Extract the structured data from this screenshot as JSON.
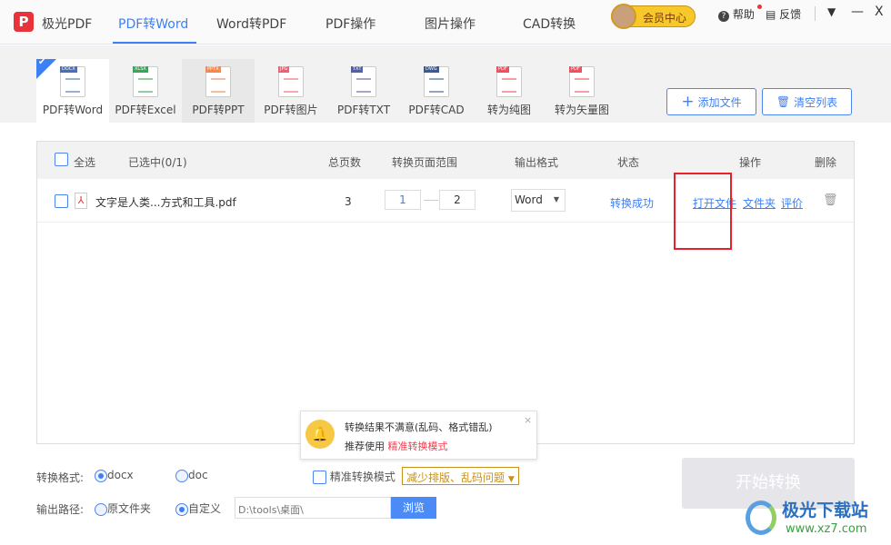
{
  "app": {
    "name": "极光PDF",
    "accent": "#3d7ff5"
  },
  "nav": [
    "PDF转Word",
    "Word转PDF",
    "PDF操作",
    "图片操作",
    "CAD转换"
  ],
  "header": {
    "member": "会员中心",
    "help": "帮助",
    "feedback": "反馈"
  },
  "tools": [
    {
      "label": "PDF转Word",
      "tag": "DOCX",
      "color": "#4a6fb5",
      "icon": "word-doc-icon"
    },
    {
      "label": "PDF转Excel",
      "tag": "XLSX",
      "color": "#3aa55a",
      "icon": "excel-doc-icon"
    },
    {
      "label": "PDF转PPT",
      "tag": "PPTX",
      "color": "#f08a50",
      "icon": "ppt-doc-icon"
    },
    {
      "label": "PDF转图片",
      "tag": "JPG",
      "color": "#f06070",
      "icon": "image-doc-icon"
    },
    {
      "label": "PDF转TXT",
      "tag": "TXT",
      "color": "#5560a0",
      "icon": "txt-doc-icon"
    },
    {
      "label": "PDF转CAD",
      "tag": "DWG",
      "color": "#3a5a90",
      "icon": "cad-doc-icon"
    },
    {
      "label": "转为纯图",
      "tag": "PDF",
      "color": "#f05060",
      "icon": "pure-image-doc-icon"
    },
    {
      "label": "转为矢量图",
      "tag": "PDF",
      "color": "#f05060",
      "icon": "vector-doc-icon"
    }
  ],
  "actions": {
    "add": "添加文件",
    "clear": "清空列表"
  },
  "table": {
    "headers": {
      "select_all": "全选",
      "selected": "已选中(0/1)",
      "pages": "总页数",
      "range": "转换页面范围",
      "format": "输出格式",
      "status": "状态",
      "ops": "操作",
      "delete": "删除"
    },
    "rows": [
      {
        "name": "文字是人类...方式和工具.pdf",
        "pages": "3",
        "from": "1",
        "to": "2",
        "format": "Word",
        "status": "转换成功",
        "open": "打开文件",
        "folder": "文件夹",
        "rate": "评价"
      }
    ]
  },
  "popup": {
    "line1": "转换结果不满意(乱码、格式错乱)",
    "line2": "推荐使用",
    "link": "精准转换模式"
  },
  "options": {
    "format_label": "转换格式:",
    "docx": "docx",
    "doc": "doc",
    "precise": "精准转换模式",
    "precise_tip": "减少排版、乱码问题",
    "path_label": "输出路径:",
    "orig": "原文件夹",
    "custom": "自定义",
    "path": "D:\\tools\\桌面\\",
    "browse": "浏览",
    "start": "开始转换"
  },
  "watermark": {
    "name": "极光下载站",
    "url": "www.xz7.com"
  }
}
